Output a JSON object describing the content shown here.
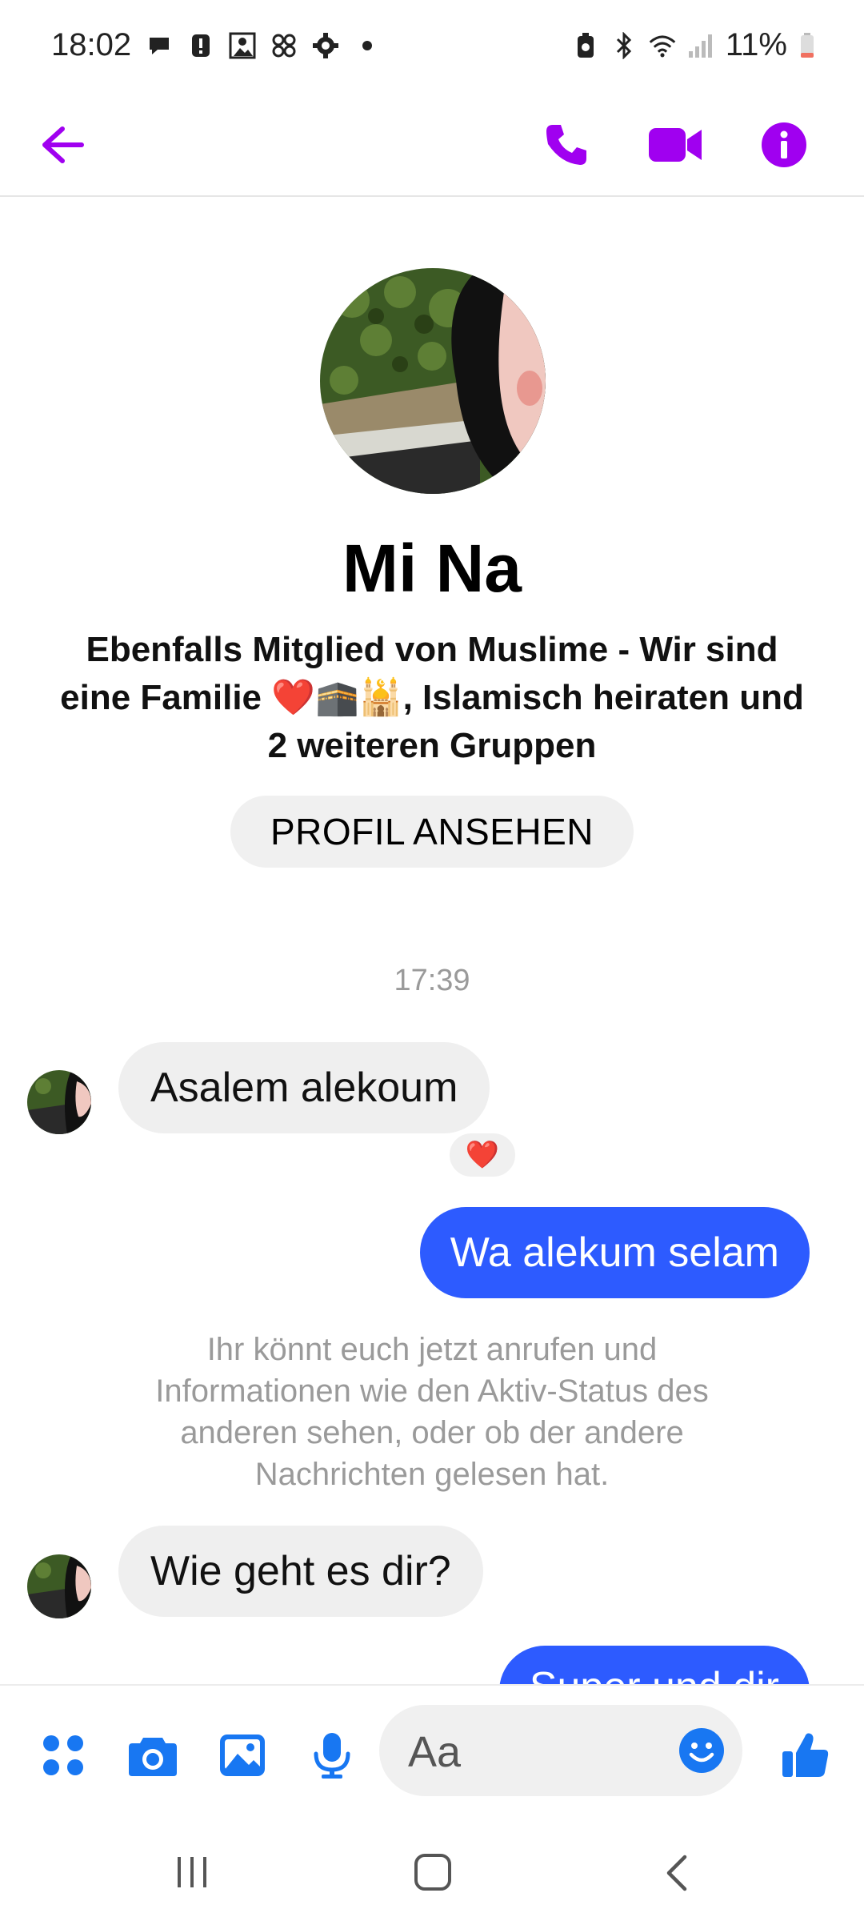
{
  "status_bar": {
    "time": "18:02",
    "battery": "11%",
    "icons_left": [
      "chat-bubble-icon",
      "alert-icon",
      "gallery-icon",
      "pinwheel-icon",
      "settings-gear-icon",
      "dot-icon"
    ],
    "icons_right": [
      "battery-saver-icon",
      "bluetooth-icon",
      "wifi-icon",
      "signal-icon",
      "battery-icon"
    ]
  },
  "header": {
    "back_icon": "arrow-left-icon",
    "actions": [
      "phone-icon",
      "video-camera-icon",
      "info-icon"
    ],
    "accent_color": "#a000f0"
  },
  "profile": {
    "name": "Mi Na",
    "description": "Ebenfalls Mitglied von Muslime - Wir sind eine Familie ❤️🕋🕌, Islamisch heiraten und 2 weiteren Gruppen",
    "view_profile_label": "PROFIL ANSEHEN"
  },
  "conversation": {
    "timestamp": "17:39",
    "messages": [
      {
        "direction": "incoming",
        "text": "Asalem alekoum",
        "reaction": "❤️"
      },
      {
        "direction": "outgoing",
        "text": "Wa alekum selam"
      },
      {
        "direction": "system",
        "text": "Ihr könnt euch jetzt anrufen und Informationen wie den Aktiv-Status des anderen sehen, oder ob der andere Nachrichten gelesen hat."
      },
      {
        "direction": "incoming",
        "text": "Wie geht es dir?"
      },
      {
        "direction": "outgoing",
        "text": "Super und dir"
      }
    ],
    "outgoing_color": "#2d5bff"
  },
  "composer": {
    "placeholder": "Aa",
    "actions": [
      "apps-grid-icon",
      "camera-icon",
      "image-icon",
      "microphone-icon"
    ],
    "emoji_icon": "smiley-icon",
    "send_icon": "thumbs-up-icon",
    "accent_color": "#1877f2"
  },
  "nav_bar": {
    "buttons": [
      "recent-apps-icon",
      "home-icon",
      "back-icon"
    ]
  }
}
